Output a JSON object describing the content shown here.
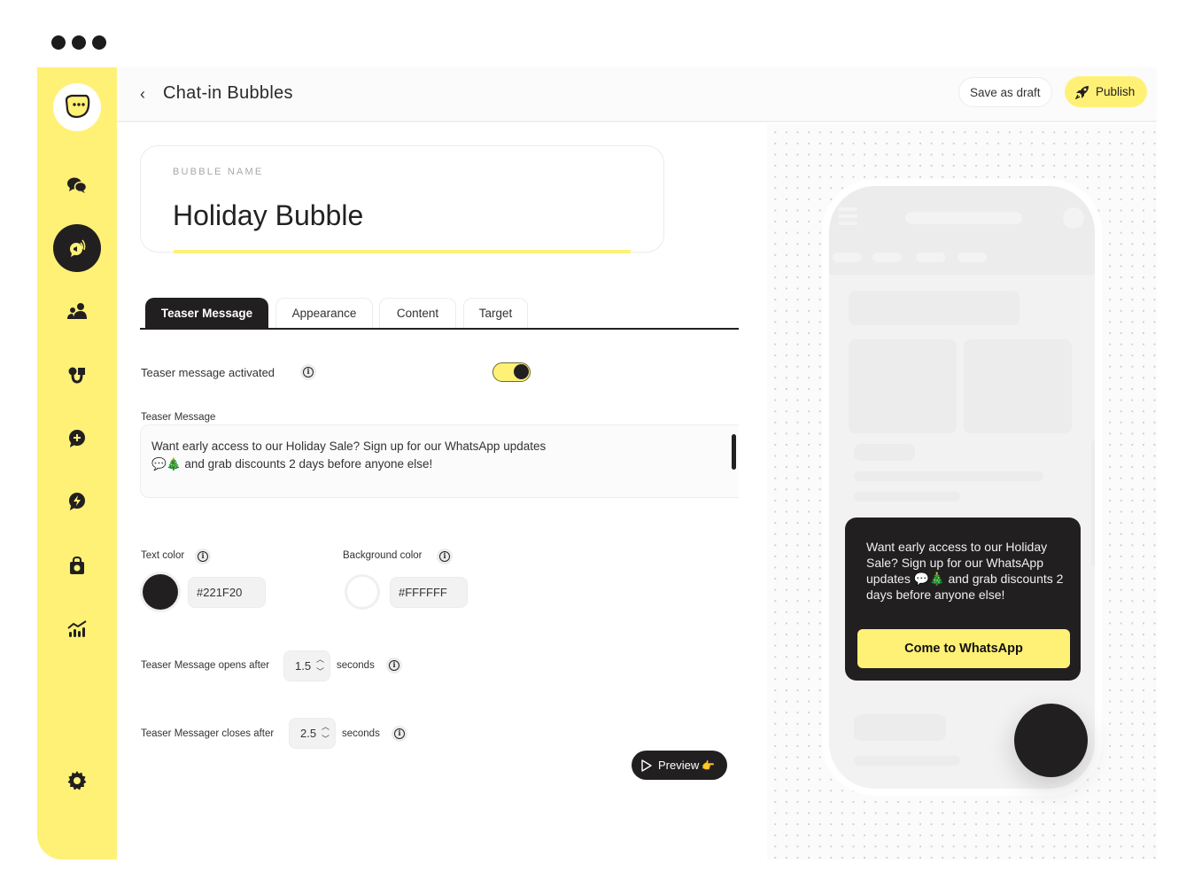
{
  "window": {
    "dots": 3
  },
  "brand": {
    "accent": "#FFF176",
    "dark": "#221F20"
  },
  "sidebar": {
    "logo": "chat-bubble-logo",
    "items": [
      {
        "name": "conversations",
        "icon": "chat-bubbles-icon",
        "active": false
      },
      {
        "name": "chat-in-bubbles",
        "icon": "megaphone-bubble-icon",
        "active": true
      },
      {
        "name": "contacts",
        "icon": "users-icon",
        "active": false
      },
      {
        "name": "integrations",
        "icon": "magnet-icon",
        "active": false
      },
      {
        "name": "new-chat",
        "icon": "add-chat-icon",
        "active": false
      },
      {
        "name": "automations",
        "icon": "flash-chat-icon",
        "active": false
      },
      {
        "name": "shop",
        "icon": "shopping-bag-icon",
        "active": false
      },
      {
        "name": "analytics",
        "icon": "chart-icon",
        "active": false
      }
    ],
    "settings_icon": "gear-icon"
  },
  "header": {
    "back": "‹",
    "title": "Chat-in Bubbles",
    "save_draft": "Save as draft",
    "publish": "Publish"
  },
  "bubble_name": {
    "label": "BUBBLE NAME",
    "value": "Holiday Bubble"
  },
  "tabs": [
    {
      "label": "Teaser Message",
      "active": true
    },
    {
      "label": "Appearance",
      "active": false
    },
    {
      "label": "Content",
      "active": false
    },
    {
      "label": "Target",
      "active": false
    }
  ],
  "teaser": {
    "activated_label": "Teaser message activated",
    "activated": true,
    "message_label": "Teaser Message",
    "message_line1": "Want early access to our Holiday Sale? Sign up for our WhatsApp updates",
    "message_line2": "💬🎄 and grab discounts 2 days before anyone else!",
    "text_color_label": "Text color",
    "text_color": "#221F20",
    "bg_color_label": "Background color",
    "bg_color": "#FFFFFF",
    "opens_label": "Teaser Message opens after",
    "opens_value": "1.5",
    "closes_label": "Teaser Messager closes after",
    "closes_value": "2.5",
    "seconds": "seconds",
    "preview_button": "Preview",
    "preview_emoji": "👉"
  },
  "phone_preview": {
    "bubble_text": "Want early access to our Holiday Sale? Sign up for our WhatsApp updates 💬🎄 and grab discounts 2 days before anyone else!",
    "cta": "Come to WhatsApp"
  }
}
